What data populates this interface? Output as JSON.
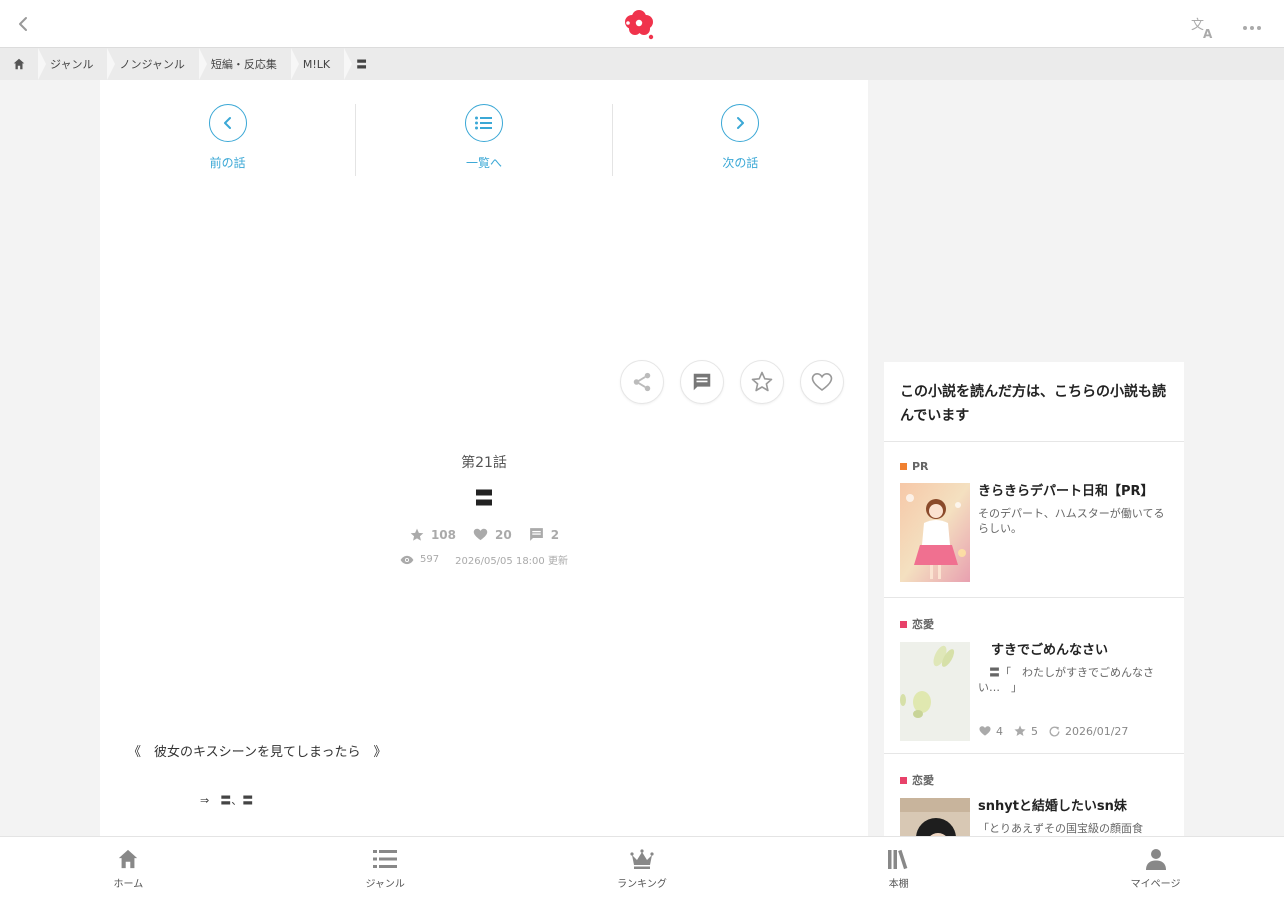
{
  "header": {
    "back_icon": "chevron-left-icon",
    "logo_icon": "flower-logo-icon",
    "translate_icon": "translate-icon",
    "more_icon": "more-horizontal-icon",
    "brand_color": "#f0334c"
  },
  "breadcrumb": {
    "home_icon": "home-icon",
    "items": [
      "ジャンル",
      "ノンジャンル",
      "短編・反応集",
      "M!LK",
      "〓"
    ]
  },
  "episode_nav": {
    "prev_label": "前の話",
    "list_label": "一覧へ",
    "next_label": "次の話",
    "accent_color": "#3ba8d6"
  },
  "actions": {
    "share_icon": "share-icon",
    "comment_icon": "comment-icon",
    "star_icon": "star-icon",
    "heart_icon": "heart-icon"
  },
  "episode": {
    "number": "第21話",
    "title": "〓",
    "stars": "108",
    "hearts": "20",
    "comments": "2",
    "views": "597",
    "updated": "2026/05/05 18:00 更新"
  },
  "body": {
    "line1": "《　彼女のキスシーンを見てしまったら　》",
    "line2": "⇒　〓、〓"
  },
  "sidebar": {
    "heading": "この小説を読んだ方は、こちらの小説も読んでいます",
    "items": [
      {
        "genre": "PR",
        "genre_color": "#f08030",
        "title": "きらきらデパート日和【PR】",
        "desc": "そのデパート、ハムスターが働いてるらしい。"
      },
      {
        "genre": "恋愛",
        "genre_color": "#e8426a",
        "title": "　すきでごめんなさい",
        "desc": "　〓「　わたしがすきでごめんなさい…　」",
        "hearts": "4",
        "stars": "5",
        "date": "2026/01/27"
      },
      {
        "genre": "恋愛",
        "genre_color": "#e8426a",
        "title": "snhytと結婚したいsn妹",
        "desc": "「とりあえずその国宝級の顔面食"
      }
    ]
  },
  "bottom_nav": [
    {
      "label": "ホーム",
      "icon": "home-icon"
    },
    {
      "label": "ジャンル",
      "icon": "list-icon"
    },
    {
      "label": "ランキング",
      "icon": "crown-icon"
    },
    {
      "label": "本棚",
      "icon": "bookshelf-icon"
    },
    {
      "label": "マイページ",
      "icon": "user-icon"
    }
  ]
}
